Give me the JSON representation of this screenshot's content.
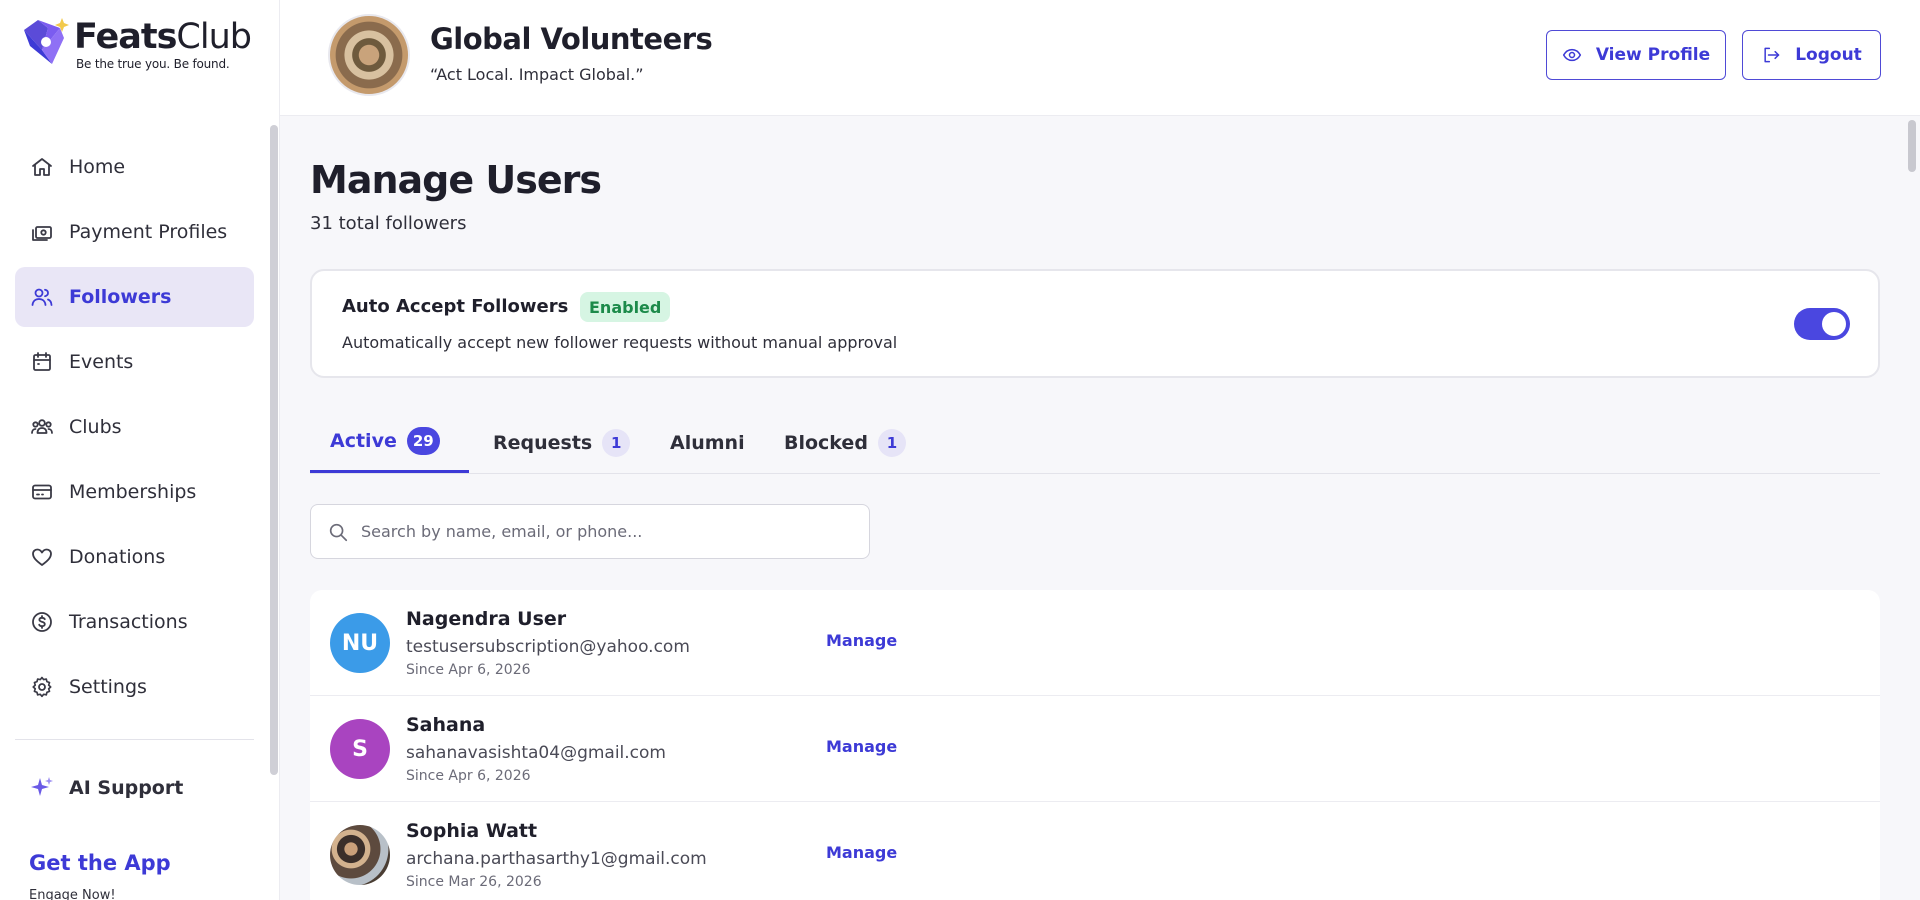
{
  "brand": {
    "name_bold": "Feats",
    "name_light": "Club",
    "tagline": "Be the true you. Be found.",
    "accent_color": "#3d3ad6"
  },
  "sidebar": {
    "items": [
      {
        "label": "Home",
        "icon": "home-icon",
        "active": false
      },
      {
        "label": "Payment Profiles",
        "icon": "cash-icon",
        "active": false
      },
      {
        "label": "Followers",
        "icon": "users-icon",
        "active": true
      },
      {
        "label": "Events",
        "icon": "calendar-icon",
        "active": false
      },
      {
        "label": "Clubs",
        "icon": "group-icon",
        "active": false
      },
      {
        "label": "Memberships",
        "icon": "card-icon",
        "active": false
      },
      {
        "label": "Donations",
        "icon": "heart-icon",
        "active": false
      },
      {
        "label": "Transactions",
        "icon": "dollar-circle-icon",
        "active": false
      },
      {
        "label": "Settings",
        "icon": "gear-icon",
        "active": false
      }
    ],
    "ai_support": "AI Support",
    "get_app": "Get the App",
    "engage": "Engage Now!"
  },
  "header": {
    "org_name": "Global Volunteers",
    "org_motto": "“Act Local. Impact Global.”",
    "view_profile": "View Profile",
    "logout": "Logout"
  },
  "main": {
    "title": "Manage Users",
    "subtitle": "31 total followers",
    "auto_accept": {
      "title": "Auto Accept Followers",
      "status": "Enabled",
      "description": "Automatically accept new follower requests without manual approval",
      "toggle_on": true
    },
    "tabs": [
      {
        "label": "Active",
        "count": "29"
      },
      {
        "label": "Requests",
        "count": "1"
      },
      {
        "label": "Alumni",
        "count": ""
      },
      {
        "label": "Blocked",
        "count": "1"
      }
    ],
    "search": {
      "placeholder": "Search by name, email, or phone...",
      "value": ""
    },
    "users": [
      {
        "initials": "NU",
        "name": "Nagendra User",
        "email": "testusersubscription@yahoo.com",
        "since": "Since Apr 6, 2026",
        "action": "Manage",
        "avatar_color": "#3b9be8"
      },
      {
        "initials": "S",
        "name": "Sahana",
        "email": "sahanavasishta04@gmail.com",
        "since": "Since Apr 6, 2026",
        "action": "Manage",
        "avatar_color": "#a944c0"
      },
      {
        "initials": "",
        "name": "Sophia Watt",
        "email": "archana.parthasarthy1@gmail.com",
        "since": "Since Mar 26, 2026",
        "action": "Manage",
        "avatar_color": ""
      }
    ]
  }
}
